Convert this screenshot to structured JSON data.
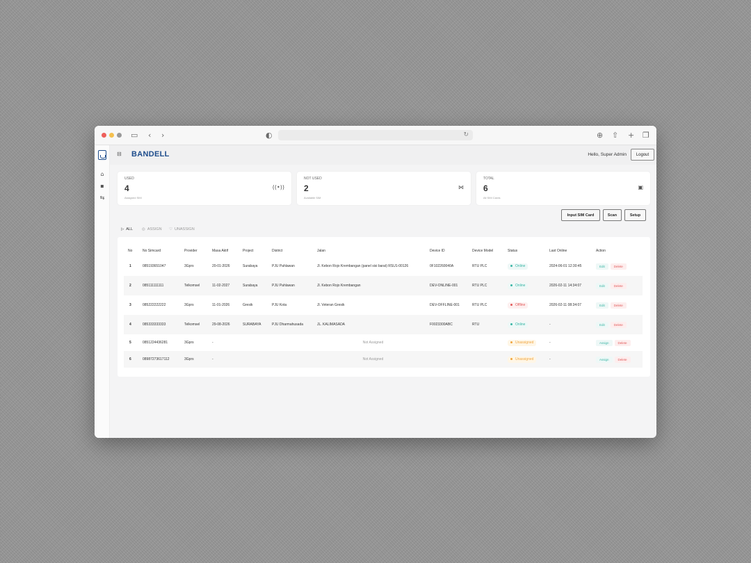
{
  "browser": {
    "icons": {
      "sidebar": "sidebar-toggle-icon",
      "back": "chevron-left-icon",
      "forward": "chevron-right-icon",
      "shield": "shield-icon",
      "reload": "reload-icon",
      "download": "download-icon",
      "share": "share-icon",
      "new_tab": "plus-icon",
      "tabs": "tabs-overview-icon"
    }
  },
  "header": {
    "brand": "BANDELL",
    "greeting": "Hello, Super Admin",
    "logout_label": "Logout"
  },
  "stats": [
    {
      "label": "USED",
      "value": "4",
      "sub": "Assigned SIM",
      "icon": "broadcast-icon"
    },
    {
      "label": "NOT USED",
      "value": "2",
      "sub": "Available SIM",
      "icon": "antenna-off-icon"
    },
    {
      "label": "TOTAL",
      "value": "6",
      "sub": "All SIM Cards",
      "icon": "sim-card-icon"
    }
  ],
  "actions": {
    "input_sim": "Input SIM Card",
    "scan": "Scan",
    "setup": "Setup"
  },
  "tabs": [
    {
      "label": "ALL",
      "icon": "play-icon"
    },
    {
      "label": "ASSIGN",
      "icon": "check-circle-icon"
    },
    {
      "label": "UNASSIGN",
      "icon": "heart-icon"
    }
  ],
  "table": {
    "headers": [
      "No",
      "No Simcard",
      "Provider",
      "Masa Aktif",
      "Project",
      "District",
      "Jalan",
      "Device ID",
      "Device Model",
      "Status",
      "Last Online",
      "Action"
    ],
    "rows": [
      {
        "no": "1",
        "sim": "085193651047",
        "provider": "3Gprs",
        "masa": "20-01-2026",
        "project": "Surabaya",
        "district": "PJU Pahlawan",
        "jalan": "Jl. Kebon Rojo Krembangan (panel sisi barat) RSU1-00126",
        "device_id": "0F102260040A",
        "model": "RTU PLC",
        "status": "Online",
        "last": "2024-06-01 12:30:45",
        "btn1": "Edit",
        "btn2": "Delete"
      },
      {
        "no": "2",
        "sim": "085111111111",
        "provider": "Telkomsel",
        "masa": "11-02-2027",
        "project": "Surabaya",
        "district": "PJU Pahlawan",
        "jalan": "Jl. Kebon Rojo Krembangan",
        "device_id": "DEV-ONLINE-001",
        "model": "RTU PLC",
        "status": "Online",
        "last": "2026-02-11 14:34:07",
        "btn1": "Edit",
        "btn2": "Delete"
      },
      {
        "no": "3",
        "sim": "085222222222",
        "provider": "3Gprs",
        "masa": "11-01-2026",
        "project": "Gresik",
        "district": "PJU Kota",
        "jalan": "Jl. Veteran Gresik",
        "device_id": "DEV-OFFLINE-001",
        "model": "RTU PLC",
        "status": "Offline",
        "last": "2026-02-11 08:34:07",
        "btn1": "Edit",
        "btn2": "Delete"
      },
      {
        "no": "4",
        "sim": "085333333333",
        "provider": "Telkomsel",
        "masa": "29-08-2026",
        "project": "SURABAYA",
        "district": "PJU Dharmahusada",
        "jalan": "JL. KALIMASADA",
        "device_id": "F0023300ABC",
        "model": "RTU",
        "status": "Online",
        "last": "-",
        "btn1": "Edit",
        "btn2": "Delete"
      },
      {
        "no": "5",
        "sim": "0851224436281",
        "provider": "3Gprs",
        "masa": "-",
        "not_assigned": "Not Assigned",
        "status": "Unassigned",
        "last": "-",
        "btn1": "Assign",
        "btn2": "Delete"
      },
      {
        "no": "6",
        "sim": "08987273617112",
        "provider": "3Gprs",
        "masa": "-",
        "not_assigned": "Not Assigned",
        "status": "Unassigned",
        "last": "-",
        "btn1": "Assign",
        "btn2": "Delete"
      }
    ]
  }
}
